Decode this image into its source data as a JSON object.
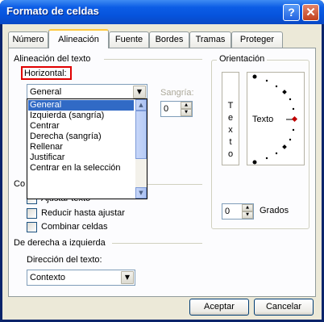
{
  "window": {
    "title": "Formato de celdas"
  },
  "tabs": [
    {
      "label": "Número"
    },
    {
      "label": "Alineación"
    },
    {
      "label": "Fuente"
    },
    {
      "label": "Bordes"
    },
    {
      "label": "Tramas"
    },
    {
      "label": "Proteger"
    }
  ],
  "alignment": {
    "section_label": "Alineación del texto",
    "horizontal_label": "Horizontal:",
    "horizontal_value": "General",
    "horizontal_options": [
      "General",
      "Izquierda (sangría)",
      "Centrar",
      "Derecha (sangría)",
      "Rellenar",
      "Justificar",
      "Centrar en la selección"
    ],
    "indent_label": "Sangría:",
    "indent_value": "0"
  },
  "text_control": {
    "section_label_partial": "Co",
    "wrap_label_partial": "Ajustar texto",
    "shrink_label": "Reducir hasta ajustar",
    "merge_label": "Combinar celdas"
  },
  "rtl": {
    "section_label": "De derecha a izquierda",
    "direction_label": "Dirección del texto:",
    "direction_value": "Contexto"
  },
  "orientation": {
    "section_label": "Orientación",
    "vertical_text": [
      "T",
      "e",
      "x",
      "t",
      "o"
    ],
    "dial_text": "Texto",
    "degrees_value": "0",
    "degrees_label": "Grados"
  },
  "buttons": {
    "ok": "Aceptar",
    "cancel": "Cancelar"
  },
  "colors": {
    "title_bar": "#0a49c4",
    "highlight": "#316ac5",
    "focus_box": "#e00000",
    "dial_pointer": "#c00000"
  }
}
